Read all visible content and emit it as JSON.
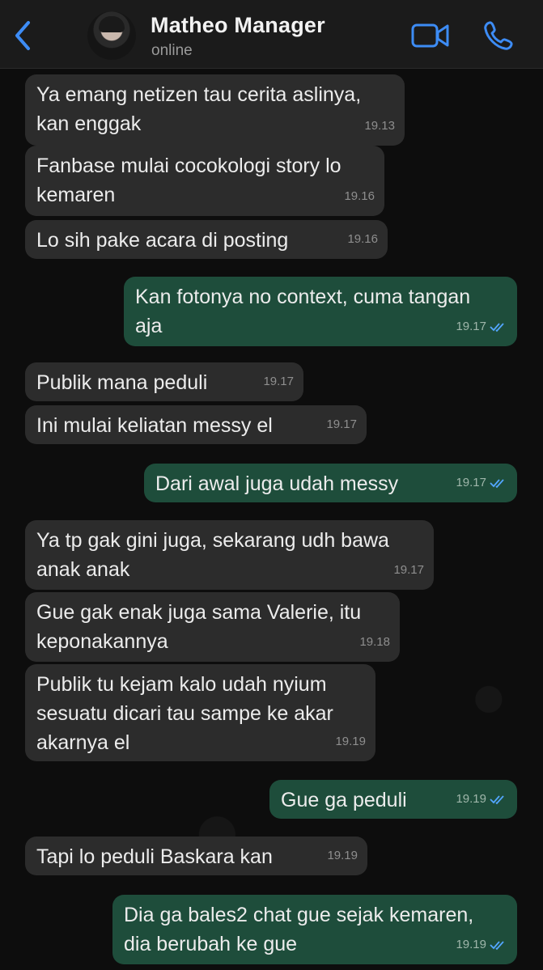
{
  "header": {
    "contact_name": "Matheo Manager",
    "status": "online",
    "accent_color": "#3d8cf5"
  },
  "messages": [
    {
      "direction": "in",
      "text": "Ya emang netizen tau cerita aslinya,\nkan enggak",
      "time": "19.13"
    },
    {
      "direction": "in",
      "text": "Fanbase mulai cocokologi story lo\nkemaren",
      "time": "19.16"
    },
    {
      "direction": "in",
      "text": "Lo sih pake acara di posting",
      "time": "19.16"
    },
    {
      "direction": "out",
      "text": "Kan fotonya no context, cuma tangan\naja",
      "time": "19.17",
      "status": "read"
    },
    {
      "direction": "in",
      "text": "Publik mana peduli",
      "time": "19.17"
    },
    {
      "direction": "in",
      "text": "Ini mulai keliatan messy el",
      "time": "19.17"
    },
    {
      "direction": "out",
      "text": "Dari awal juga udah messy",
      "time": "19.17",
      "status": "read"
    },
    {
      "direction": "in",
      "text": "Ya tp gak gini juga, sekarang udh bawa\nanak anak",
      "time": "19.17"
    },
    {
      "direction": "in",
      "text": "Gue gak enak juga sama Valerie, itu\nkeponakannya",
      "time": "19.18"
    },
    {
      "direction": "in",
      "text": "Publik tu kejam kalo udah nyium\nsesuatu dicari tau sampe ke akar\nakarnya el",
      "time": "19.19"
    },
    {
      "direction": "out",
      "text": "Gue ga peduli",
      "time": "19.19",
      "status": "read"
    },
    {
      "direction": "in",
      "text": "Tapi lo peduli Baskara kan",
      "time": "19.19"
    },
    {
      "direction": "out",
      "text": "Dia ga bales2 chat gue sejak kemaren,\ndia berubah ke gue",
      "time": "19.19",
      "status": "read"
    }
  ]
}
